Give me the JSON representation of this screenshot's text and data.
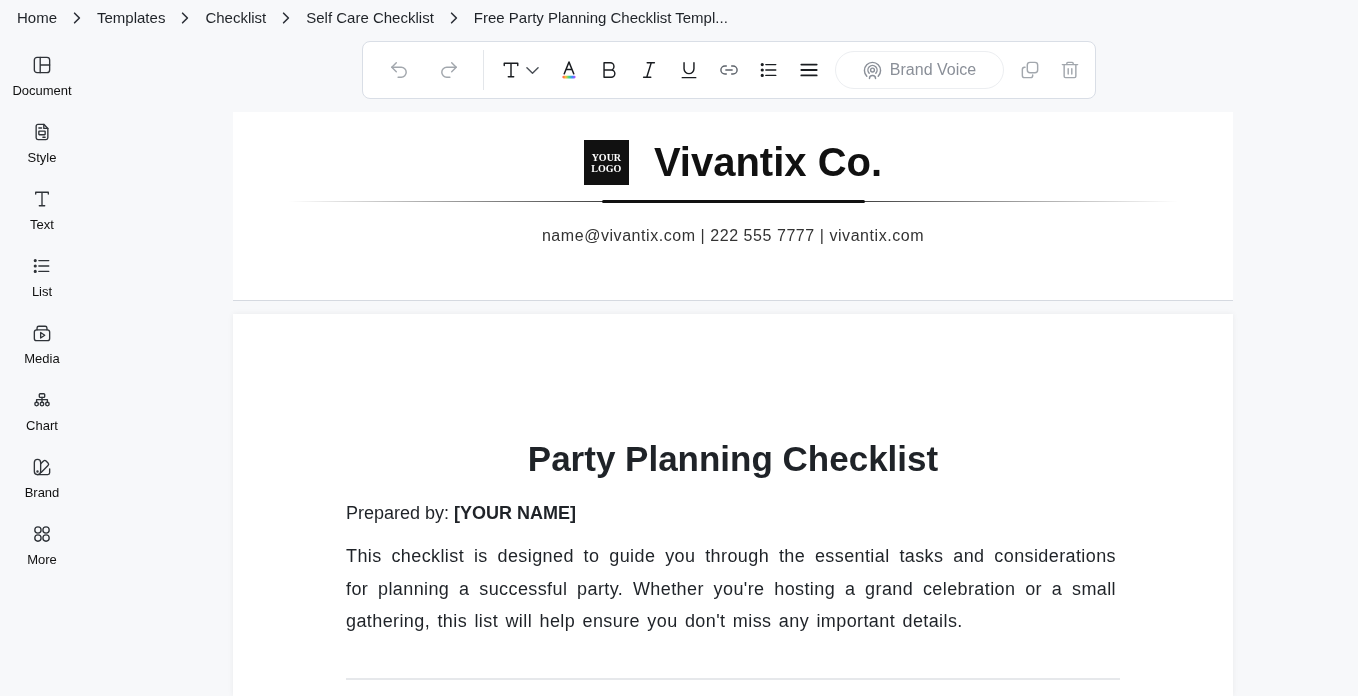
{
  "breadcrumb": [
    {
      "label": "Home"
    },
    {
      "label": "Templates"
    },
    {
      "label": "Checklist"
    },
    {
      "label": "Self Care Checklist"
    },
    {
      "label": "Free Party Planning Checklist Templ..."
    }
  ],
  "sidebar": {
    "items": [
      {
        "label": "Document"
      },
      {
        "label": "Style"
      },
      {
        "label": "Text"
      },
      {
        "label": "List"
      },
      {
        "label": "Media"
      },
      {
        "label": "Chart"
      },
      {
        "label": "Brand"
      },
      {
        "label": "More"
      }
    ]
  },
  "toolbar": {
    "groups": [
      {
        "buttons": [
          {
            "kind": "undo",
            "disabled": true
          },
          {
            "kind": "redo",
            "disabled": true
          }
        ]
      },
      {
        "buttons": [
          {
            "kind": "text_style",
            "disabled": false
          },
          {
            "kind": "text_color",
            "disabled": false
          },
          {
            "kind": "bold",
            "disabled": false
          },
          {
            "kind": "italic",
            "disabled": false
          },
          {
            "kind": "underline",
            "disabled": false
          },
          {
            "kind": "link",
            "disabled": false
          },
          {
            "kind": "bullet_list",
            "disabled": false
          },
          {
            "kind": "align",
            "disabled": false
          },
          {
            "kind": "brand_voice",
            "label": "Brand Voice",
            "disabled": true
          },
          {
            "kind": "duplicate",
            "disabled": true
          },
          {
            "kind": "delete",
            "disabled": true
          }
        ]
      }
    ]
  },
  "document": {
    "header": {
      "logo": "YOUR LOGO",
      "company": "Vivantix Co.",
      "contact": "name@vivantix.com | 222 555 7777 | vivantix.com"
    },
    "page": {
      "title": "Party Planning Checklist",
      "prepared_by": "Prepared by: **[YOUR NAME]**",
      "intro": "This checklist is designed to guide you through the essential tasks and considerations for planning a successful party. Whether you're hosting a grand celebration or a small gathering, this list will help ensure you don't miss any important details."
    }
  }
}
